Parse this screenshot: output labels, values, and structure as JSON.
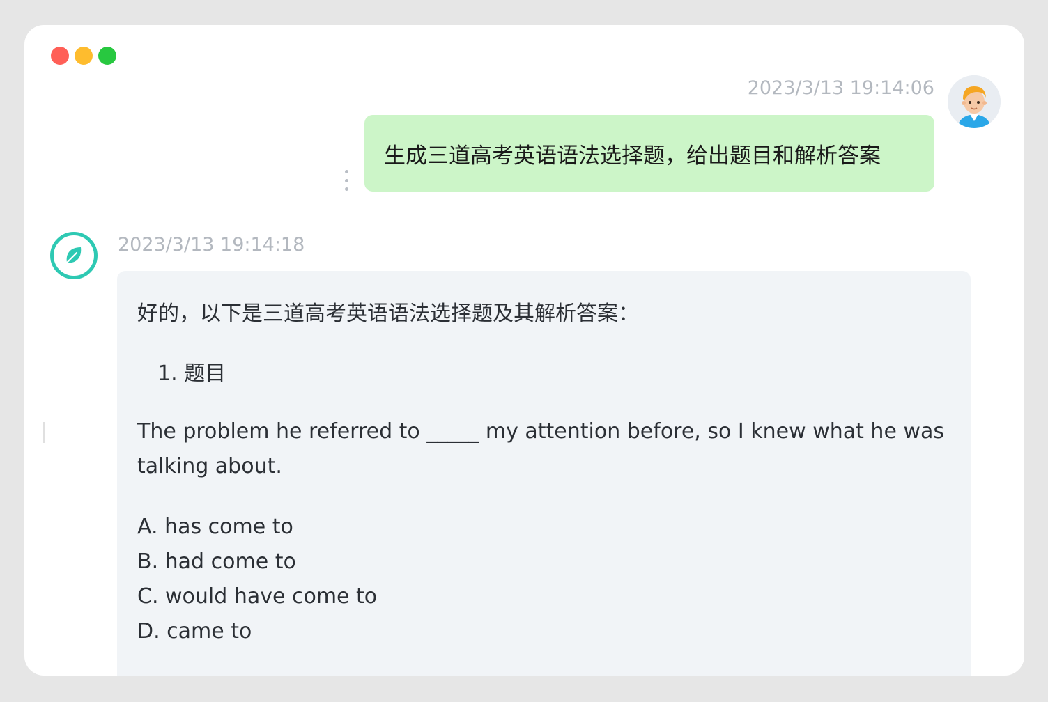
{
  "window": {
    "traffic_lights": {
      "close": "#ff5f57",
      "minimize": "#febc2e",
      "zoom": "#28c840"
    }
  },
  "user_message": {
    "timestamp": "2023/3/13 19:14:06",
    "text": "生成三道高考英语语法选择题，给出题目和解析答案",
    "bubble_color": "#ccf5c8",
    "avatar_icon": "cartoon-user-avatar-icon",
    "more_icon": "vertical-ellipsis-icon"
  },
  "bot_message": {
    "timestamp": "2023/3/13 19:14:18",
    "avatar_icon": "leaf-logo-icon",
    "accent_color": "#2ec9b3",
    "intro": "好的，以下是三道高考英语语法选择题及其解析答案：",
    "question_heading": "1. 题目",
    "question_text": "The problem he referred to _____ my attention before, so I knew what he was talking about.",
    "options": [
      "A. has come to",
      "B. had come to",
      "C. would have come to",
      "D. came to"
    ]
  }
}
